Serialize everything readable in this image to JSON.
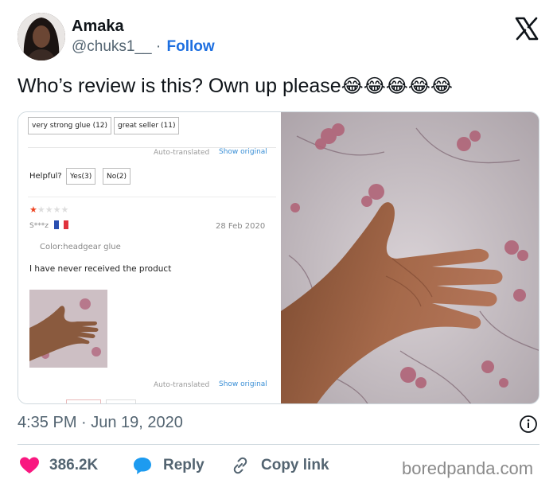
{
  "author": {
    "name": "Amaka",
    "handle": "@chuks1__",
    "separator": "·",
    "follow_label": "Follow"
  },
  "platform_logo": "x-logo-icon",
  "tweet": {
    "text": "Who’s review is this? Own up please",
    "emojis": [
      "😂",
      "😂",
      "😂",
      "😂",
      "😂"
    ],
    "timestamp": "4:35 PM · Jun 19, 2020"
  },
  "review_screenshot": {
    "tags": [
      "very strong glue (12)",
      "great seller (11)"
    ],
    "auto_translated": "Auto-translated",
    "show_original": "Show original",
    "helpful_label": "Helpful?",
    "yes_label": "Yes(3)",
    "no_label": "No(2)",
    "rating": {
      "value": 1,
      "max": 5
    },
    "reviewer": "S***z",
    "country_flag": "france-flag-icon",
    "date": "28 Feb 2020",
    "color_line": "Color:headgear glue",
    "review_text": "I have never received the product",
    "auto_translated_bottom": "Auto-translated",
    "show_original_bottom": "Show original"
  },
  "actions": {
    "like_count": "386.2K",
    "reply_label": "Reply",
    "copy_link_label": "Copy link"
  },
  "watermark": "boredpanda.com",
  "colors": {
    "like": "#f91880",
    "reply": "#1d9bf0",
    "follow": "#1d6fe0",
    "muted": "#536471"
  }
}
